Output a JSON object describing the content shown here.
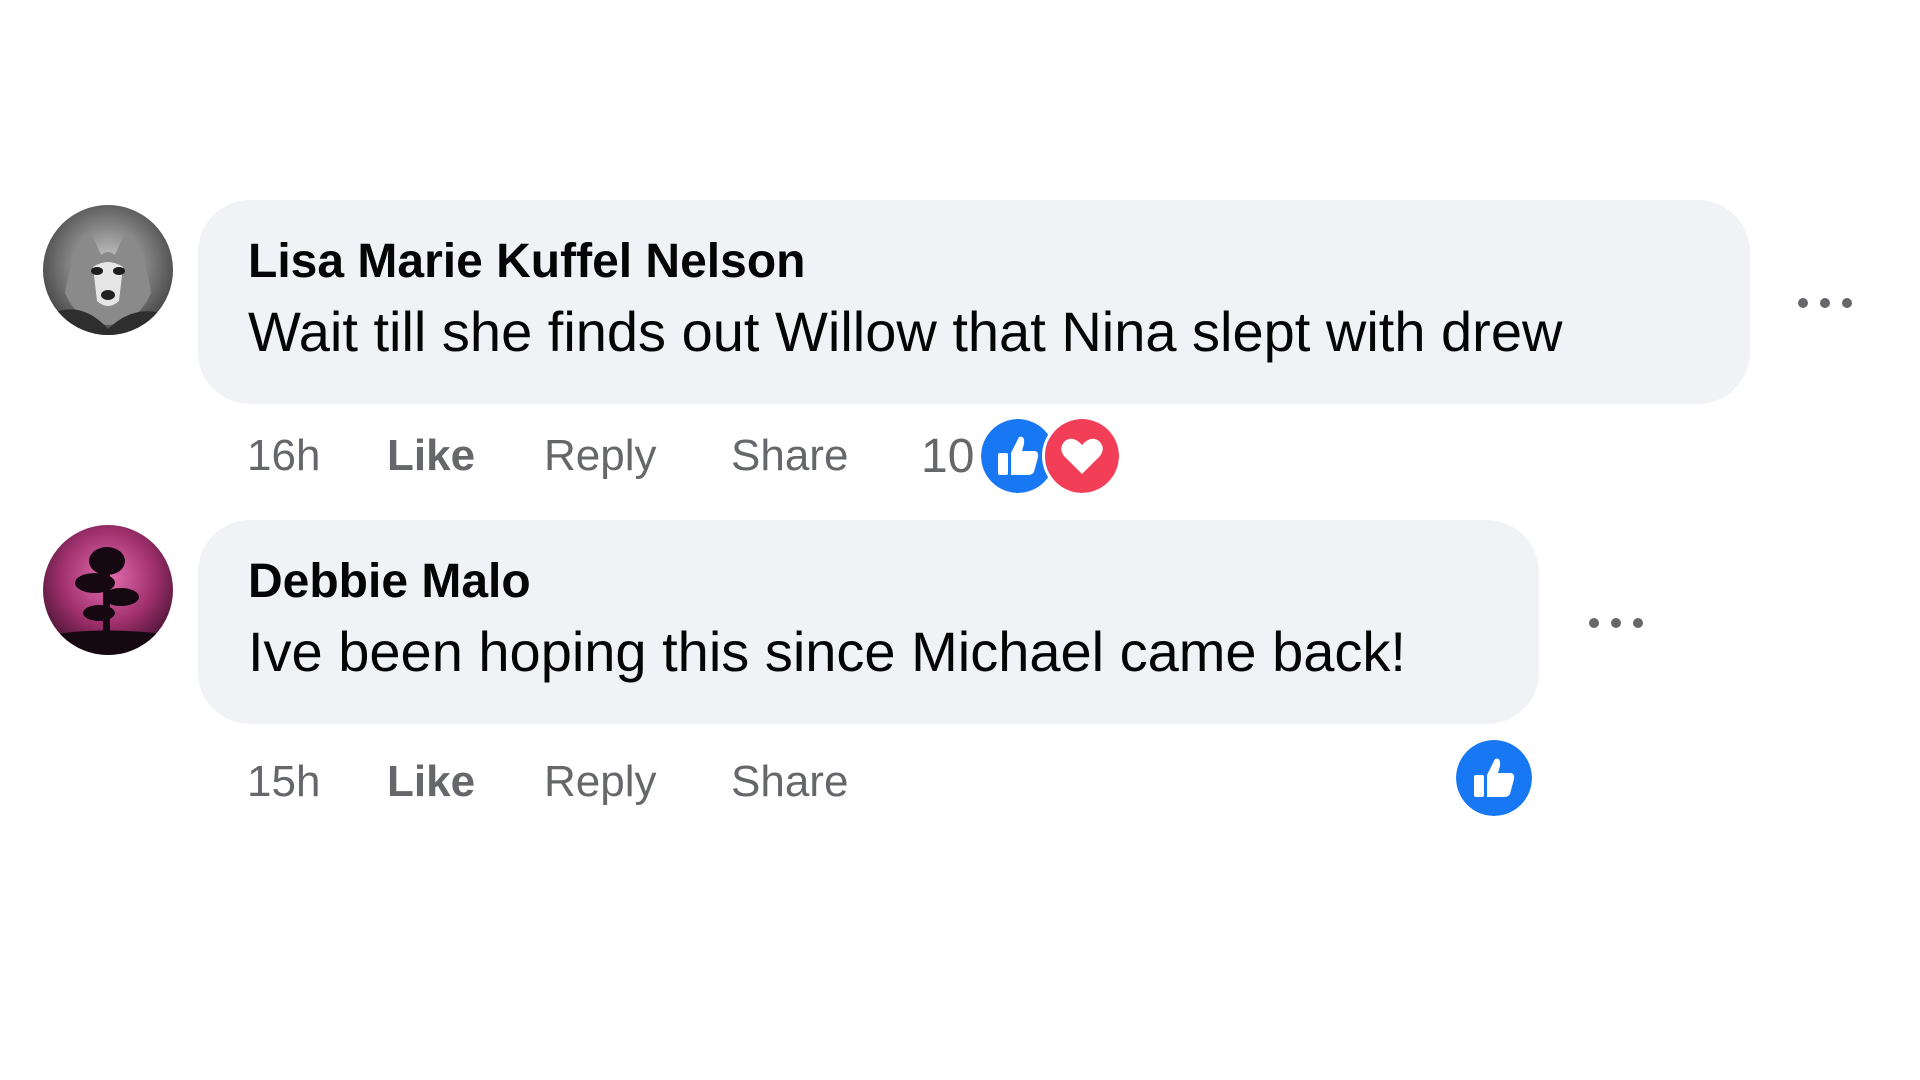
{
  "colors": {
    "bubble_bg": "#f0f2f5",
    "text_primary": "#050505",
    "text_secondary": "#65676b",
    "like_blue": "#1877f2",
    "love_red": "#f33e58"
  },
  "comments": [
    {
      "author": "Lisa Marie Kuffel Nelson",
      "text": "Wait till she finds out Willow that Nina slept with drew",
      "timestamp": "16h",
      "like_label": "Like",
      "reply_label": "Reply",
      "share_label": "Share",
      "reaction_count": "10",
      "reactions": [
        "like-icon",
        "love-icon"
      ],
      "avatar_icon": "husky-dog-avatar",
      "more_icon": "more-options-icon"
    },
    {
      "author": "Debbie Malo",
      "text": "Ive been hoping this since Michael came back!",
      "timestamp": "15h",
      "like_label": "Like",
      "reply_label": "Reply",
      "share_label": "Share",
      "reactions": [
        "like-icon"
      ],
      "avatar_icon": "pink-tree-avatar",
      "more_icon": "more-options-icon"
    }
  ]
}
